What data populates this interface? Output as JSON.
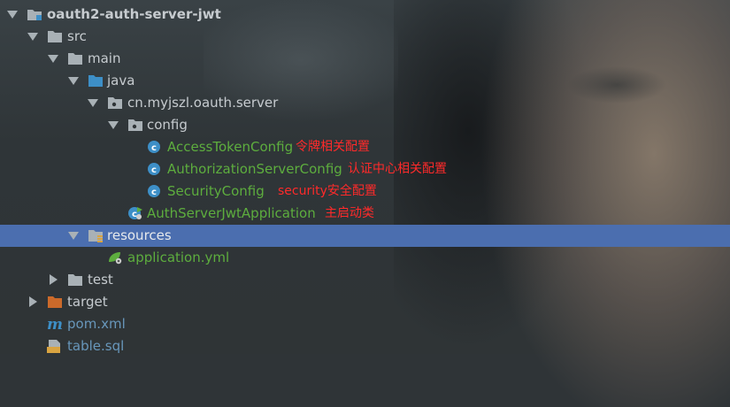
{
  "tree": {
    "project": "oauth2-auth-server-jwt",
    "src": "src",
    "main": "main",
    "java": "java",
    "package": "cn.myjszl.oauth.server",
    "config": "config",
    "files": {
      "access_token_config": "AccessTokenConfig",
      "authorization_server_config": "AuthorizationServerConfig",
      "security_config": "SecurityConfig",
      "application_class": "AuthServerJwtApplication"
    },
    "resources": "resources",
    "application_yml": "application.yml",
    "test": "test",
    "target": "target",
    "pom": "pom.xml",
    "table_sql": "table.sql"
  },
  "notes": {
    "access_token_config": "令牌相关配置",
    "authorization_server_config": "认证中心相关配置",
    "security_config": "security安全配置",
    "application_class": "主启动类"
  },
  "icons": {
    "folder": "folder-icon",
    "source-folder": "source-folder-icon",
    "package": "package-icon",
    "class": "class-icon",
    "spring-boot-app": "spring-boot-icon",
    "resources-folder": "resources-folder-icon",
    "yaml": "yaml-icon",
    "excluded-folder": "excluded-folder-icon",
    "maven": "maven-icon",
    "sql": "sql-icon"
  },
  "colors": {
    "selection": "#4b6eaf",
    "class_name": "#5dad3e",
    "annotation_note": "#ff2a2a",
    "folder": "#a9b1b6",
    "source_folder": "#3d8fc7",
    "target_folder": "#cc6a2a"
  }
}
